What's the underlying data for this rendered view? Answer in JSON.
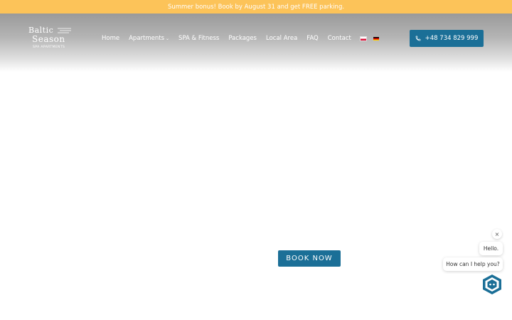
{
  "promo": {
    "text": "Summer bonus! Book by August 31 and get FREE parking."
  },
  "logo": {
    "line1": "Baltic",
    "line2": "Season",
    "subtitle": "SPA APARTMENTS"
  },
  "nav": {
    "items": [
      {
        "label": "Home"
      },
      {
        "label": "Apartments",
        "has_dropdown": true,
        "chevron": "⌄"
      },
      {
        "label": "SPA & Fitness"
      },
      {
        "label": "Packages"
      },
      {
        "label": "Local Area"
      },
      {
        "label": "FAQ"
      },
      {
        "label": "Contact"
      }
    ],
    "languages": [
      {
        "code": "pl",
        "icon": "flag-pl-icon"
      },
      {
        "code": "de",
        "icon": "flag-de-icon"
      }
    ]
  },
  "phone_button": {
    "label": "+48 734 829 999",
    "icon": "phone-icon"
  },
  "hero": {
    "book_label": "BOOK NOW"
  },
  "chat": {
    "close_symbol": "×",
    "greeting": "Hello.",
    "prompt": "How can I help you?",
    "launcher_icon": "chat-bot-icon"
  },
  "colors": {
    "promo_bg": "#fcc359",
    "primary": "#1b6f97",
    "text_light": "#ffffff"
  }
}
